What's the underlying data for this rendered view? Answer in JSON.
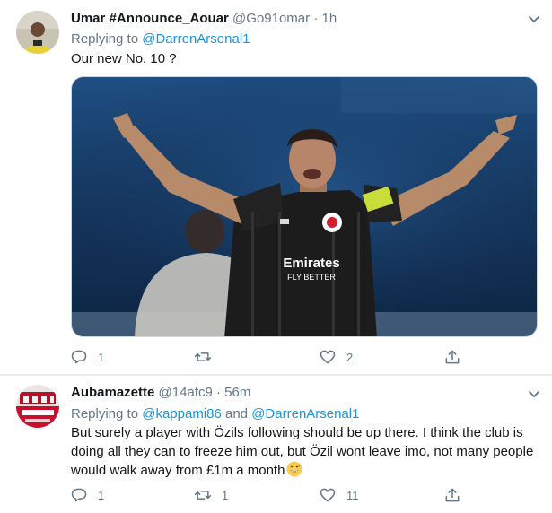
{
  "tweets": [
    {
      "name": "Umar #Announce_Aouar",
      "handle": "@Go91omar",
      "dot": "·",
      "time": "1h",
      "replying_prefix": "Replying to ",
      "replying_mentions": [
        "@DarrenArsenal1"
      ],
      "replying_joiner": "",
      "text": "Our new No. 10 ?",
      "media": {
        "sponsor_line1": "Emirates",
        "sponsor_line2": "FLY BETTER"
      },
      "actions": {
        "replies": "1",
        "retweets": "",
        "likes": "2"
      }
    },
    {
      "name": "Aubamazette",
      "handle": "@14afc9",
      "dot": "·",
      "time": "56m",
      "replying_prefix": "Replying to ",
      "replying_mentions": [
        "@kappami86",
        "@DarrenArsenal1"
      ],
      "replying_joiner": " and ",
      "text": "But surely a player with Özils following should be up there. I think the club is doing all they can to freeze him out, but Özil wont leave imo, not many people would walk away from £1m a month",
      "actions": {
        "replies": "1",
        "retweets": "1",
        "likes": "11"
      }
    }
  ],
  "colors": {
    "link": "#1b95e0",
    "secondary": "#657786",
    "primary": "#14171a",
    "border": "#e6ecf0"
  },
  "icons": [
    "chevron-down-icon",
    "reply-icon",
    "retweet-icon",
    "like-icon",
    "share-icon",
    "grinning-sweat-emoji"
  ]
}
